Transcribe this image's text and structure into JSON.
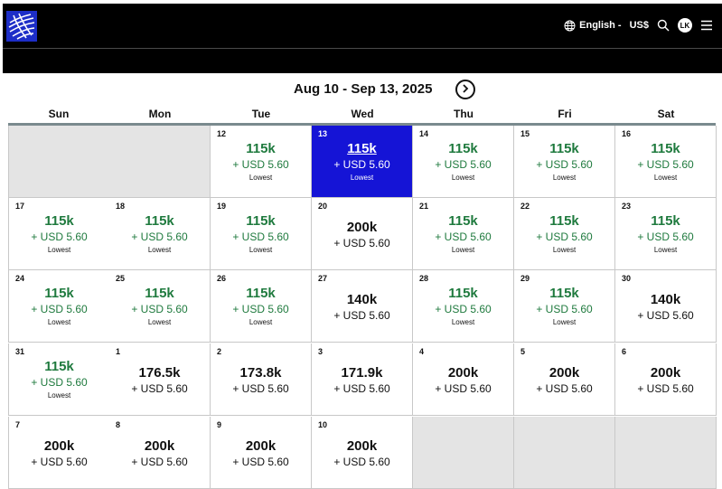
{
  "header": {
    "logo_icon": "globe-logo-icon",
    "language_label": "English -",
    "currency_label": "US$",
    "profile_initials": "LK"
  },
  "calendar": {
    "range_title": "Aug 10 - Sep 13, 2025",
    "weekdays": [
      "Sun",
      "Mon",
      "Tue",
      "Wed",
      "Thu",
      "Fri",
      "Sat"
    ],
    "weeks": [
      [
        {
          "empty": true
        },
        {
          "empty": true
        },
        {
          "day": "12",
          "miles": "115k",
          "fee": "+ USD 5.60",
          "tag": "Lowest"
        },
        {
          "day": "13",
          "miles": "115k",
          "fee": "+ USD 5.60",
          "tag": "Lowest",
          "selected": true
        },
        {
          "day": "14",
          "miles": "115k",
          "fee": "+ USD 5.60",
          "tag": "Lowest"
        },
        {
          "day": "15",
          "miles": "115k",
          "fee": "+ USD 5.60",
          "tag": "Lowest"
        },
        {
          "day": "16",
          "miles": "115k",
          "fee": "+ USD 5.60",
          "tag": "Lowest"
        }
      ],
      [
        {
          "day": "17",
          "miles": "115k",
          "fee": "+ USD 5.60",
          "tag": "Lowest"
        },
        {
          "day": "18",
          "miles": "115k",
          "fee": "+ USD 5.60",
          "tag": "Lowest"
        },
        {
          "day": "19",
          "miles": "115k",
          "fee": "+ USD 5.60",
          "tag": "Lowest"
        },
        {
          "day": "20",
          "miles": "200k",
          "fee": "+ USD 5.60"
        },
        {
          "day": "21",
          "miles": "115k",
          "fee": "+ USD 5.60",
          "tag": "Lowest"
        },
        {
          "day": "22",
          "miles": "115k",
          "fee": "+ USD 5.60",
          "tag": "Lowest"
        },
        {
          "day": "23",
          "miles": "115k",
          "fee": "+ USD 5.60",
          "tag": "Lowest"
        }
      ],
      [
        {
          "day": "24",
          "miles": "115k",
          "fee": "+ USD 5.60",
          "tag": "Lowest"
        },
        {
          "day": "25",
          "miles": "115k",
          "fee": "+ USD 5.60",
          "tag": "Lowest"
        },
        {
          "day": "26",
          "miles": "115k",
          "fee": "+ USD 5.60",
          "tag": "Lowest"
        },
        {
          "day": "27",
          "miles": "140k",
          "fee": "+ USD 5.60"
        },
        {
          "day": "28",
          "miles": "115k",
          "fee": "+ USD 5.60",
          "tag": "Lowest"
        },
        {
          "day": "29",
          "miles": "115k",
          "fee": "+ USD 5.60",
          "tag": "Lowest"
        },
        {
          "day": "30",
          "miles": "140k",
          "fee": "+ USD 5.60"
        }
      ],
      [
        {
          "day": "31",
          "miles": "115k",
          "fee": "+ USD 5.60",
          "tag": "Lowest"
        },
        {
          "day": "1",
          "miles": "176.5k",
          "fee": "+ USD 5.60"
        },
        {
          "day": "2",
          "miles": "173.8k",
          "fee": "+ USD 5.60"
        },
        {
          "day": "3",
          "miles": "171.9k",
          "fee": "+ USD 5.60"
        },
        {
          "day": "4",
          "miles": "200k",
          "fee": "+ USD 5.60"
        },
        {
          "day": "5",
          "miles": "200k",
          "fee": "+ USD 5.60"
        },
        {
          "day": "6",
          "miles": "200k",
          "fee": "+ USD 5.60"
        }
      ],
      [
        {
          "day": "7",
          "miles": "200k",
          "fee": "+ USD 5.60"
        },
        {
          "day": "8",
          "miles": "200k",
          "fee": "+ USD 5.60"
        },
        {
          "day": "9",
          "miles": "200k",
          "fee": "+ USD 5.60"
        },
        {
          "day": "10",
          "miles": "200k",
          "fee": "+ USD 5.60"
        },
        {
          "empty": true
        },
        {
          "empty": true
        },
        {
          "empty": true
        }
      ]
    ]
  },
  "colors": {
    "lowest_price": "#1f7a3e",
    "selected_cell": "#1514d6",
    "empty_cell": "#e4e4e4",
    "logo_blue": "#1d2ec8"
  }
}
